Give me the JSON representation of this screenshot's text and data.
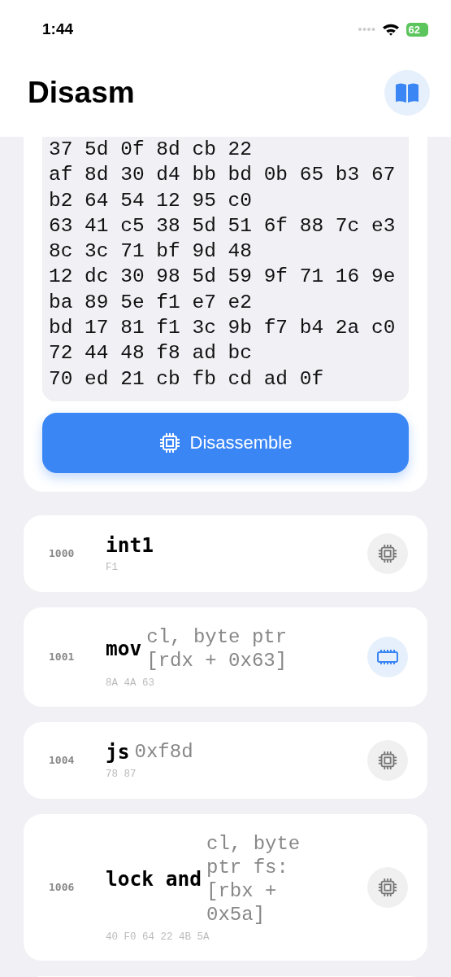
{
  "status_bar": {
    "time": "1:44",
    "battery": "62"
  },
  "header": {
    "title": "Disasm"
  },
  "hex_lines": [
    "37 5d 0f 8d cb 22",
    "af 8d 30 d4 bb bd 0b 65 b3 67",
    "b2 64 54 12 95 c0",
    "63 41 c5 38 5d 51 6f 88 7c e3",
    "8c 3c 71 bf 9d 48",
    "12 dc 30 98 5d 59 9f 71 16 9e",
    "ba 89 5e f1 e7 e2",
    "bd 17 81 f1 3c 9b f7 b4 2a c0",
    "72 44 48 f8 ad bc",
    "70 ed 21 cb fb cd ad 0f"
  ],
  "disassemble_button": {
    "label": "Disassemble"
  },
  "instructions": [
    {
      "address": "1000",
      "mnemonic": "int1",
      "bytes": "F1",
      "kind": "chip"
    },
    {
      "address": "1001",
      "mnemonic": "mov",
      "operands": "cl, byte ptr [rdx + 0x63]",
      "bytes": "8A 4A 63",
      "kind": "memory"
    },
    {
      "address": "1004",
      "mnemonic": "js",
      "operands": "0xf8d",
      "bytes": "78 87",
      "kind": "chip"
    },
    {
      "address": "1006",
      "mnemonic": "lock and",
      "operands": "cl, byte ptr fs: [rbx + 0x5a]",
      "bytes": "40 F0 64 22 4B 5A",
      "kind": "chip"
    }
  ]
}
